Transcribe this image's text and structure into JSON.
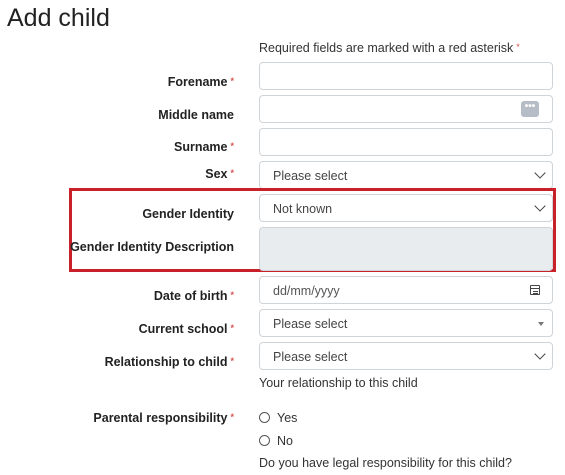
{
  "page": {
    "title": "Add child"
  },
  "form": {
    "required_note": "Required fields are marked with a red asterisk",
    "asterisk": "*",
    "forename": {
      "label": "Forename",
      "value": ""
    },
    "middle_name": {
      "label": "Middle name",
      "value": "",
      "button_icon": "ellipsis-icon",
      "button_text": "•••"
    },
    "surname": {
      "label": "Surname",
      "value": ""
    },
    "sex": {
      "label": "Sex",
      "selected": "Please select"
    },
    "gender_identity": {
      "label": "Gender Identity",
      "selected": "Not known"
    },
    "gender_identity_description": {
      "label": "Gender Identity Description",
      "value": ""
    },
    "date_of_birth": {
      "label": "Date of birth",
      "placeholder": "dd/mm/yyyy",
      "icon": "calendar-icon"
    },
    "current_school": {
      "label": "Current school",
      "selected": "Please select"
    },
    "relationship": {
      "label": "Relationship to child",
      "selected": "Please select",
      "help": "Your relationship to this child"
    },
    "parental_responsibility": {
      "label": "Parental responsibility",
      "options": [
        "Yes",
        "No"
      ],
      "help": "Do you have legal responsibility for this child?"
    }
  },
  "colors": {
    "highlight": "#c9212a",
    "asterisk": "#d9534f",
    "disabled_bg": "#e9ecef"
  }
}
